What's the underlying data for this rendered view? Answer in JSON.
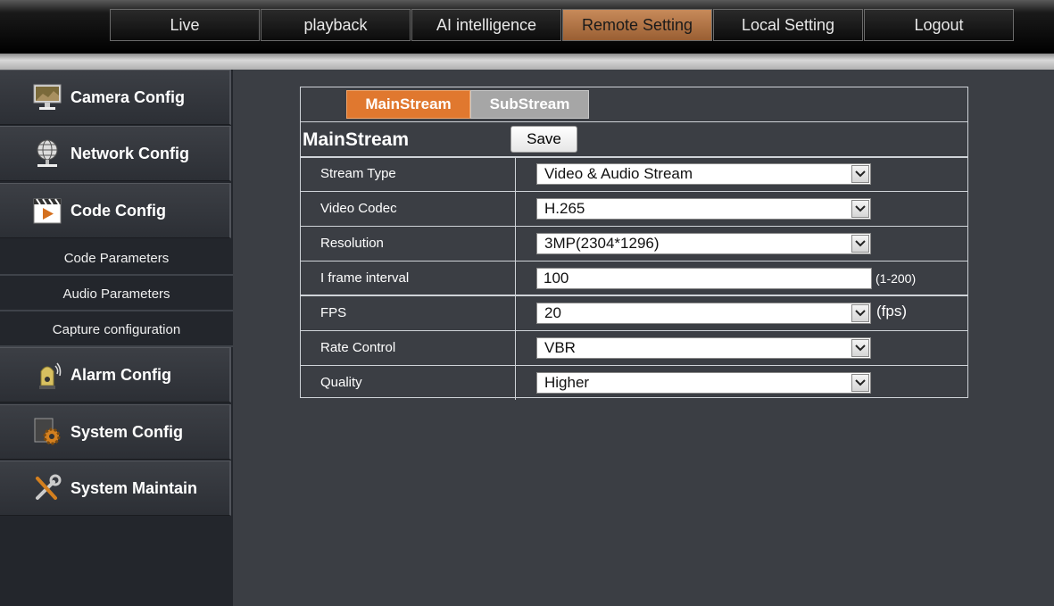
{
  "nav": {
    "items": [
      "Live",
      "playback",
      "AI intelligence",
      "Remote Setting",
      "Local Setting",
      "Logout"
    ],
    "active": "Remote Setting",
    "active_color": "#b0703f"
  },
  "sidebar": {
    "camera_config": "Camera Config",
    "network_config": "Network Config",
    "code_config": "Code Config",
    "sub_items": [
      "Code Parameters",
      "Audio Parameters",
      "Capture configuration"
    ],
    "alarm_config": "Alarm Config",
    "system_config": "System Config",
    "system_maintain": "System Maintain"
  },
  "panel": {
    "tabs": {
      "main": "MainStream",
      "sub": "SubStream"
    },
    "title": "MainStream",
    "save_label": "Save",
    "accent": "#e0782f",
    "rows": {
      "stream_type": {
        "label": "Stream Type",
        "value": "Video & Audio Stream"
      },
      "video_codec": {
        "label": "Video Codec",
        "value": "H.265"
      },
      "resolution": {
        "label": "Resolution",
        "value": "3MP(2304*1296)"
      },
      "i_frame": {
        "label": "I frame interval",
        "value": "100",
        "range": "(1-200)"
      },
      "fps": {
        "label": "FPS",
        "value": "20",
        "unit": "(fps)"
      },
      "rate_control": {
        "label": "Rate Control",
        "value": "VBR"
      },
      "quality": {
        "label": "Quality",
        "value": "Higher"
      }
    }
  }
}
